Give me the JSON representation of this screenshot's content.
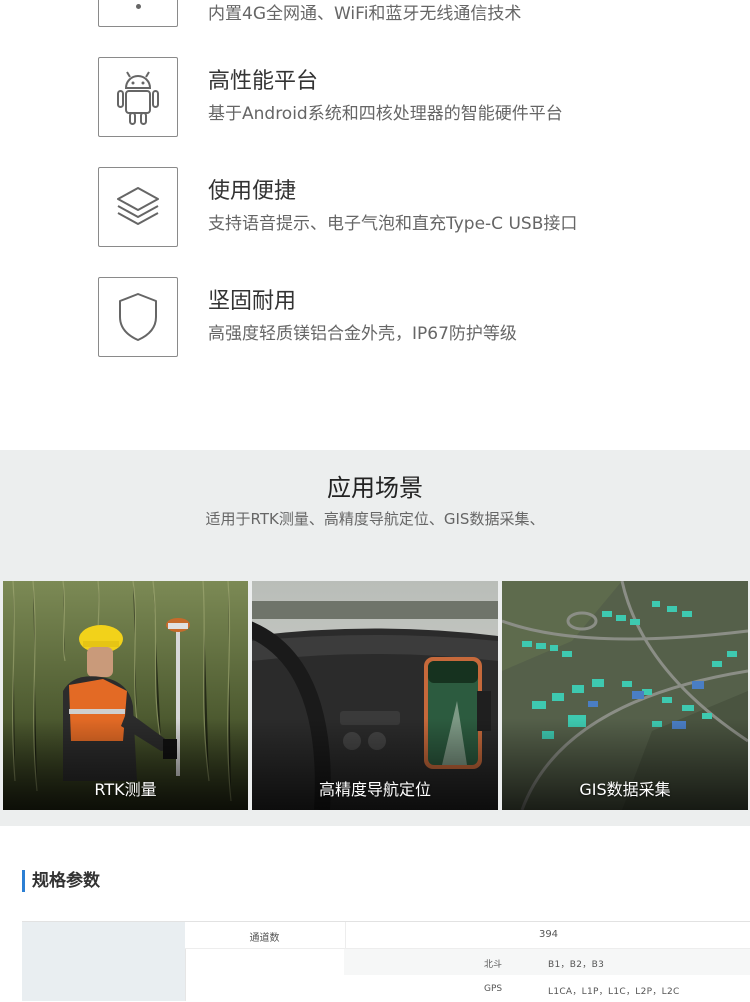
{
  "features": [
    {
      "title": "",
      "desc": "内置4G全网通、WiFi和蓝牙无线通信技术",
      "icon": "wireless-icon"
    },
    {
      "title": "高性能平台",
      "desc": "基于Android系统和四核处理器的智能硬件平台",
      "icon": "android-icon"
    },
    {
      "title": "使用便捷",
      "desc": "支持语音提示、电子气泡和直充Type-C USB接口",
      "icon": "layers-icon"
    },
    {
      "title": "坚固耐用",
      "desc": "高强度轻质镁铝合金外壳，IP67防护等级",
      "icon": "shield-icon"
    }
  ],
  "scenes": {
    "title": "应用场景",
    "subtitle": "适用于RTK测量、高精度导航定位、GIS数据采集、",
    "cards": [
      {
        "label": "RTK测量"
      },
      {
        "label": "高精度导航定位"
      },
      {
        "label": "GIS数据采集"
      }
    ]
  },
  "specs": {
    "title": "规格参数",
    "rows": [
      {
        "key": "通道数",
        "value": "394"
      }
    ],
    "sub_rows": [
      {
        "key": "北斗",
        "value": "B1，B2，B3"
      },
      {
        "key": "GPS",
        "value": "L1CA，L1P，L1C，L2P，L2C"
      }
    ]
  }
}
